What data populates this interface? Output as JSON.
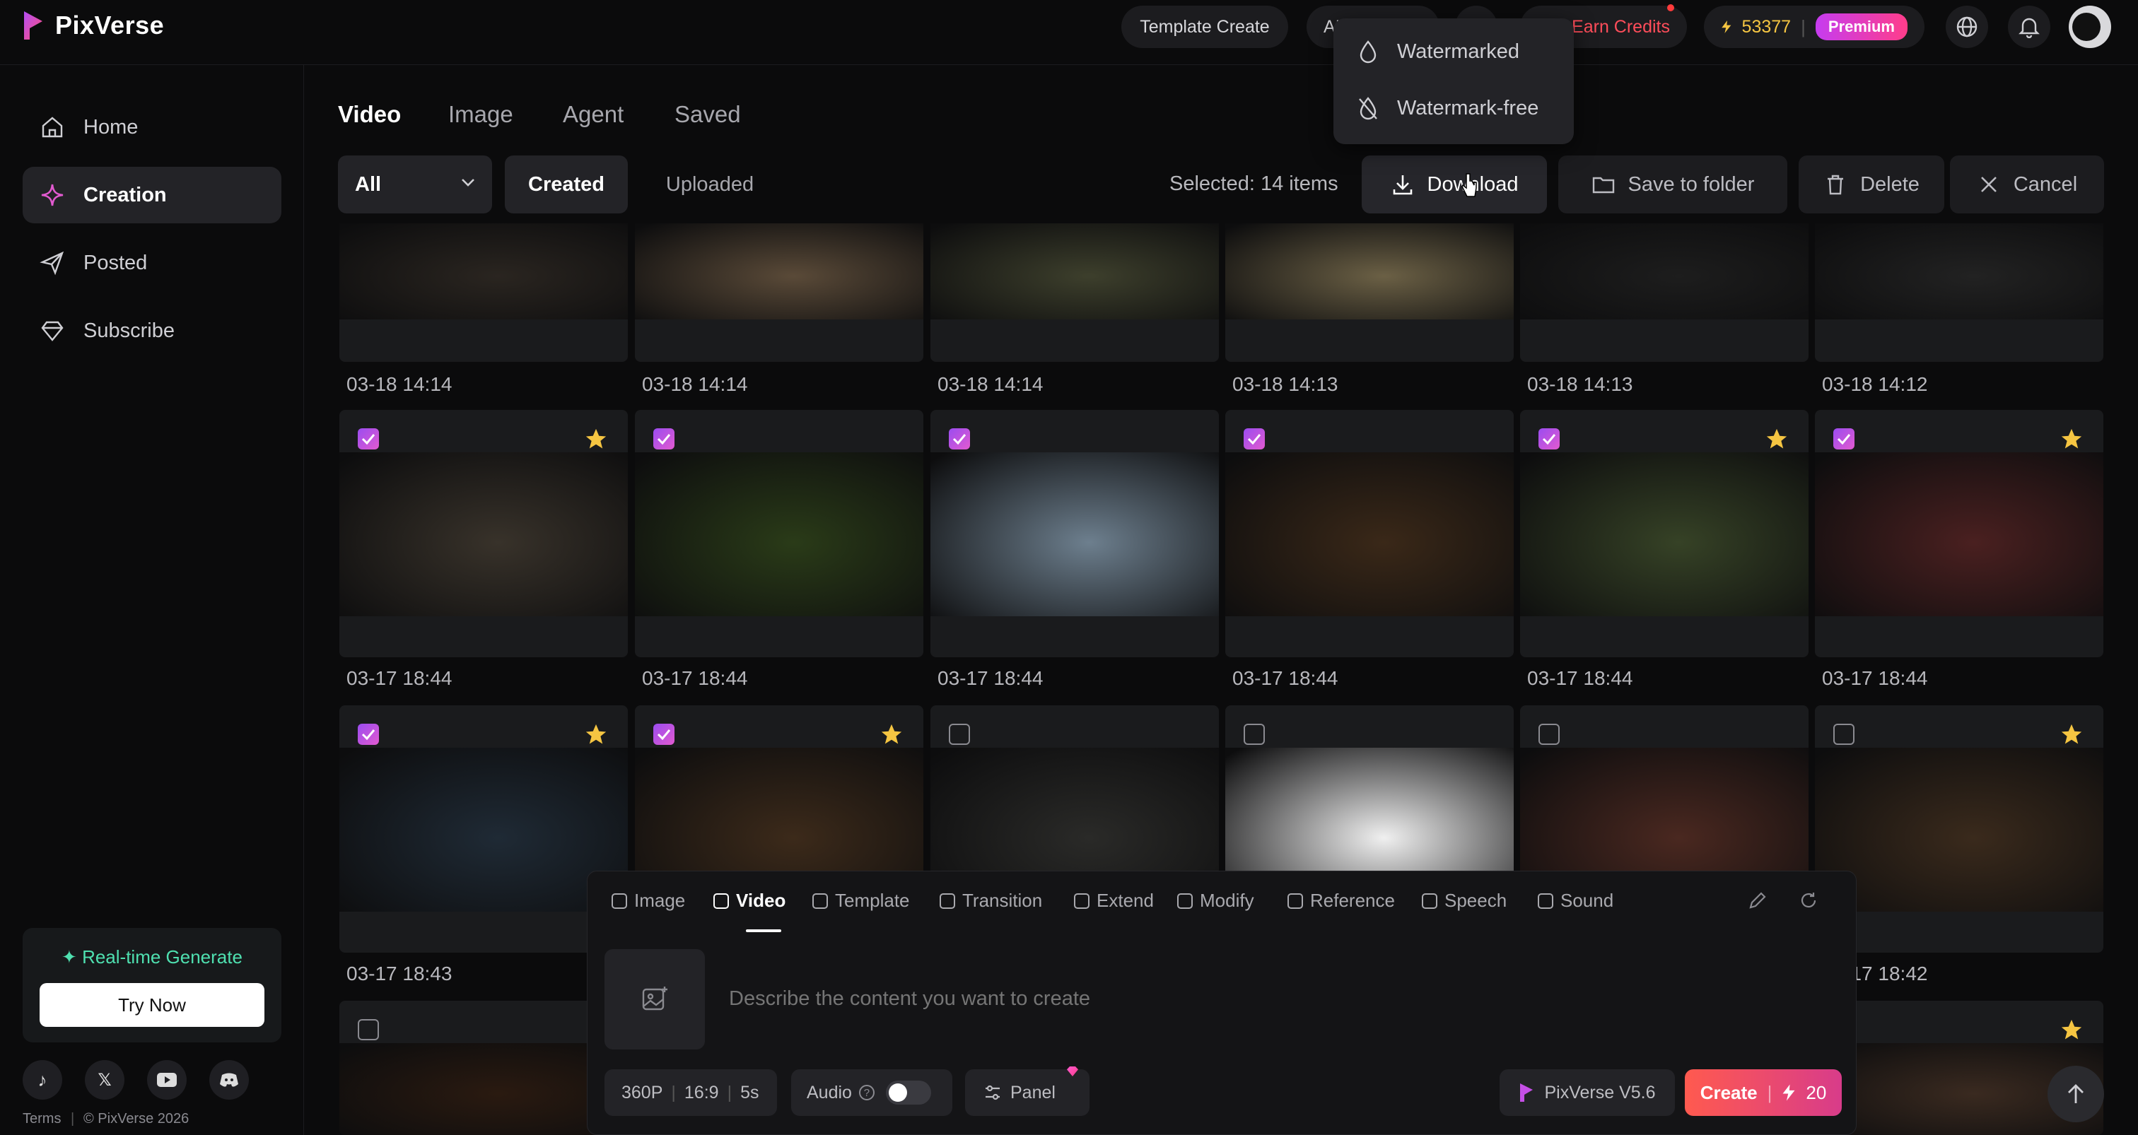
{
  "app": {
    "name": "PixVerse"
  },
  "topbar": {
    "template_create": "Template Create",
    "ai_partial": "AI",
    "earn_credits": "Earn Credits",
    "credits": "53377",
    "premium": "Premium"
  },
  "download_menu": {
    "items": [
      {
        "label": "Watermarked",
        "icon": "droplet-icon"
      },
      {
        "label": "Watermark-free",
        "icon": "droplet-off-icon"
      }
    ]
  },
  "sidebar": {
    "items": [
      {
        "label": "Home",
        "icon": "home-icon"
      },
      {
        "label": "Creation",
        "icon": "sparkle-icon",
        "active": true
      },
      {
        "label": "Posted",
        "icon": "send-icon"
      },
      {
        "label": "Subscribe",
        "icon": "diamond-icon"
      }
    ],
    "realtime": {
      "title": "Real-time Generate",
      "button": "Try Now"
    },
    "social": [
      "tiktok-icon",
      "x-icon",
      "youtube-icon",
      "discord-icon"
    ],
    "footer": {
      "terms": "Terms",
      "copyright": "© PixVerse 2026"
    }
  },
  "main": {
    "tabs": [
      {
        "label": "Video",
        "active": true
      },
      {
        "label": "Image"
      },
      {
        "label": "Agent"
      },
      {
        "label": "Saved"
      }
    ],
    "filter": {
      "selected": "All"
    },
    "segments": {
      "created": "Created",
      "uploaded": "Uploaded"
    },
    "selection": {
      "label": "Selected: 14 items",
      "download": "Download",
      "save_to_folder": "Save to folder",
      "delete": "Delete",
      "cancel": "Cancel"
    }
  },
  "grid": {
    "rows": [
      {
        "dates": [
          "03-18 14:14",
          "03-18 14:14",
          "03-18 14:14",
          "03-18 14:13",
          "03-18 14:13",
          "03-18 14:12"
        ]
      },
      {
        "dates": [
          "03-17 18:44",
          "03-17 18:44",
          "03-17 18:44",
          "03-17 18:44",
          "03-17 18:44",
          "03-17 18:44"
        ],
        "checked": [
          true,
          true,
          true,
          true,
          true,
          true
        ],
        "starred": [
          true,
          false,
          false,
          false,
          true,
          true
        ]
      },
      {
        "dates": [
          "03-17 18:43",
          "",
          "",
          "",
          "",
          "03-17 18:42"
        ],
        "checked": [
          true,
          true,
          false,
          false,
          false,
          false
        ],
        "starred": [
          true,
          true,
          false,
          false,
          false,
          true
        ]
      },
      {
        "checked": [
          false,
          null,
          null,
          null,
          null,
          null
        ],
        "starred": [
          false,
          false,
          false,
          false,
          false,
          true
        ]
      }
    ]
  },
  "composer": {
    "tabs": [
      {
        "label": "Image",
        "icon": "image-icon"
      },
      {
        "label": "Video",
        "icon": "video-icon",
        "active": true
      },
      {
        "label": "Template",
        "icon": "sparkle-icon"
      },
      {
        "label": "Transition",
        "icon": "transition-icon"
      },
      {
        "label": "Extend",
        "icon": "extend-icon"
      },
      {
        "label": "Modify",
        "icon": "modify-icon"
      },
      {
        "label": "Reference",
        "icon": "reference-icon"
      },
      {
        "label": "Speech",
        "icon": "speech-icon"
      },
      {
        "label": "Sound",
        "icon": "sound-icon"
      }
    ],
    "placeholder": "Describe the content you want to create",
    "resolution": "360P",
    "aspect": "16:9",
    "duration": "5s",
    "audio": "Audio",
    "audio_on": false,
    "panel": "Panel",
    "model": "PixVerse V5.6",
    "create": "Create",
    "cost": "20"
  },
  "colors": {
    "accent": "#e25ad0",
    "credits": "#f5c542",
    "earn": "#ff4d5a"
  }
}
